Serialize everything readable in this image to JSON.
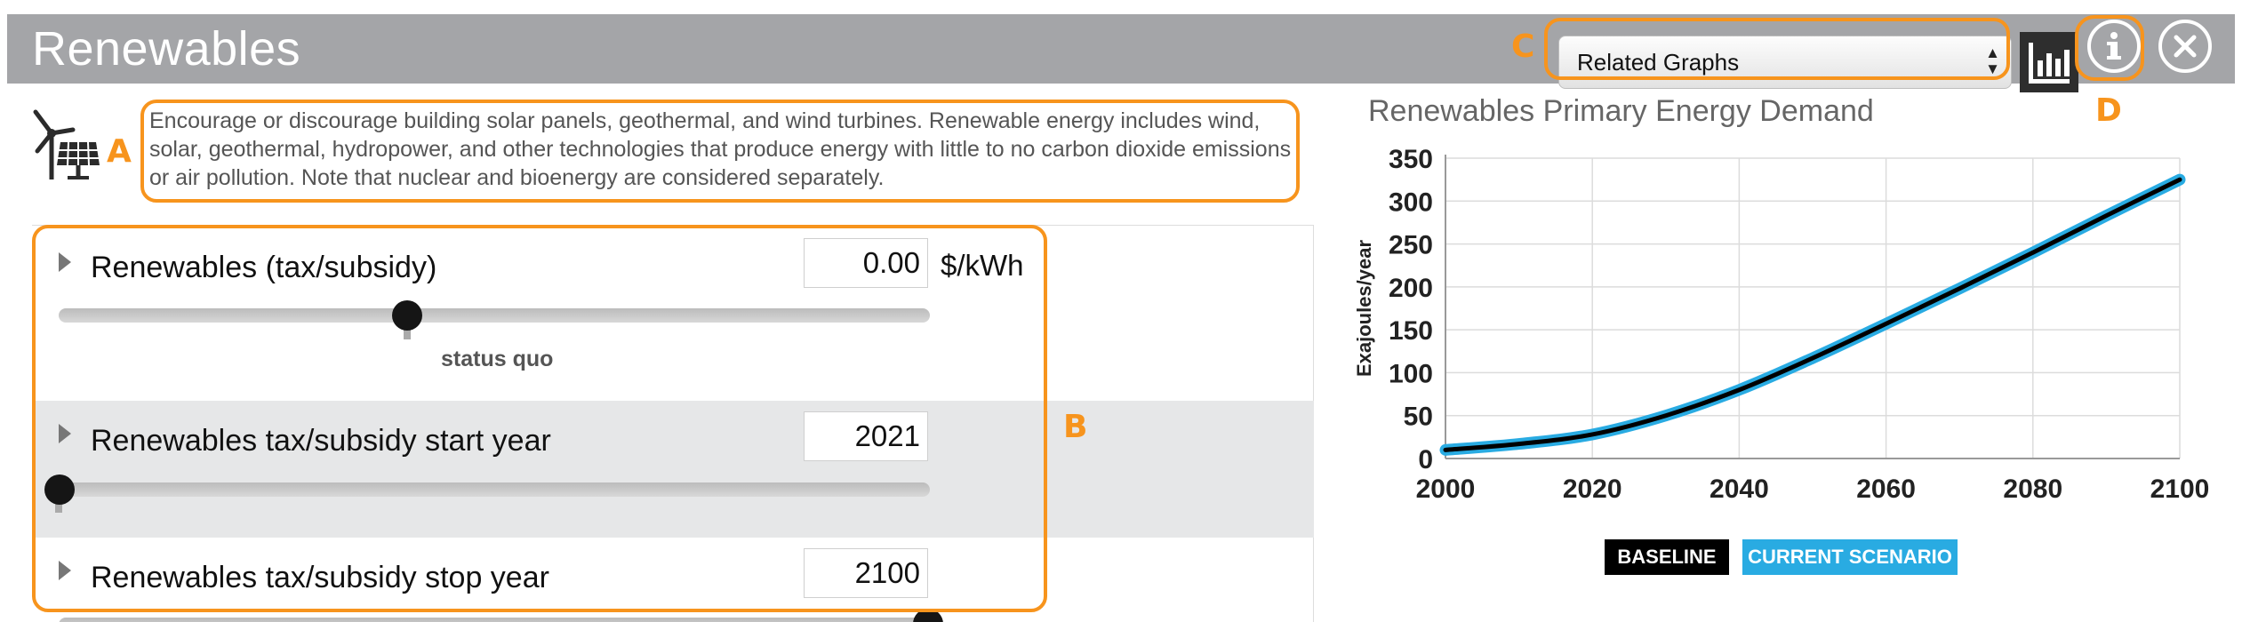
{
  "window": {
    "title": "Renewables",
    "related_graphs_label": "Related Graphs"
  },
  "annotations": {
    "a": "A",
    "b": "B",
    "c": "C",
    "d": "D"
  },
  "icons": {
    "brand": "wind-turbine-solar-panel-icon",
    "graph": "bar-chart-icon",
    "info": "info-icon",
    "close": "close-icon",
    "select": "updown-arrows-icon"
  },
  "description": "Encourage or discourage building solar panels, geothermal, and wind turbines. Renewable energy includes wind, solar, geothermal, hydropower, and other technologies that produce energy with little to no carbon dioxide emissions or air pollution. Note that nuclear and bioenergy are considered separately.",
  "controls": [
    {
      "label": "Renewables (tax/subsidy)",
      "value": "0.00",
      "unit": "$/kWh",
      "slider_fraction": 0.4,
      "slider_note": "status quo"
    },
    {
      "label": "Renewables tax/subsidy start year",
      "value": "2021",
      "slider_fraction": 0.0
    },
    {
      "label": "Renewables tax/subsidy stop year",
      "value": "2100",
      "slider_fraction": 1.0
    }
  ],
  "colors": {
    "accent": "#f7941d",
    "baseline": "#000000",
    "scenario": "#29abe2",
    "titlebar": "#a4a5a8"
  },
  "chart_data": {
    "type": "line",
    "title": "Renewables Primary Energy Demand",
    "xlabel": "",
    "ylabel": "Exajoules/year",
    "xlim": [
      2000,
      2100
    ],
    "ylim": [
      0,
      350
    ],
    "x_ticks": [
      2000,
      2020,
      2040,
      2060,
      2080,
      2100
    ],
    "y_ticks": [
      0,
      50,
      100,
      150,
      200,
      250,
      300,
      350
    ],
    "grid": true,
    "legend": "bottom",
    "x": [
      2000,
      2010,
      2020,
      2030,
      2040,
      2050,
      2060,
      2070,
      2080,
      2090,
      2100
    ],
    "series": [
      {
        "name": "BASELINE",
        "color": "#000000",
        "values": [
          10,
          17,
          28,
          50,
          80,
          117,
          157,
          198,
          240,
          283,
          325
        ]
      },
      {
        "name": "CURRENT SCENARIO",
        "color": "#29abe2",
        "values": [
          10,
          17,
          28,
          50,
          80,
          117,
          157,
          198,
          240,
          283,
          325
        ]
      }
    ]
  }
}
